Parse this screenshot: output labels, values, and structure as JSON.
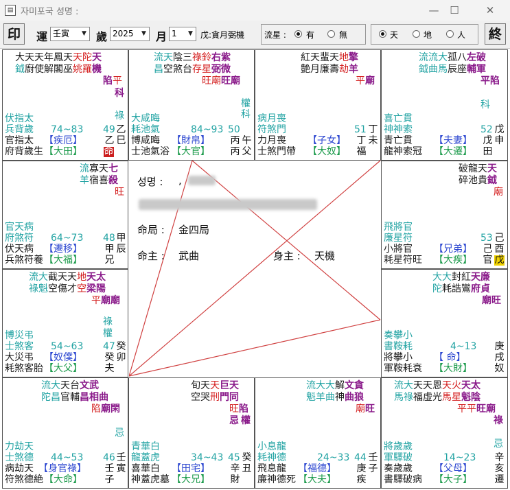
{
  "window": {
    "title": "자미포국  성명 :"
  },
  "toolbar": {
    "print_label": "印",
    "yun_label": "運",
    "yun_value": "壬寅",
    "sui_label": "歲",
    "sui_value": "2025",
    "yue_label": "月",
    "yue_value": "1",
    "sihua_text": "戊:貪月弼機",
    "liuxing_label": "流星 :",
    "liuxing_options": [
      "有",
      "無"
    ],
    "liuxing_selected": "有",
    "view_options": [
      "天",
      "地",
      "人"
    ],
    "view_selected": "天",
    "end_label": "終"
  },
  "center": {
    "name_label": "성명 :",
    "name_value": ",",
    "mingju_label": "命局 :",
    "mingju_value": "金四局",
    "mingzhu_label": "命主 :",
    "mingzhu_value": "武曲",
    "shenzhu_label": "身主 :",
    "shenzhu_value": "天機"
  },
  "cells": {
    "si": {
      "top": [
        [
          "大",
          "b"
        ],
        [
          "天",
          "b"
        ],
        [
          "天",
          "b"
        ],
        [
          "年",
          "b"
        ],
        [
          "鳳",
          "b"
        ],
        [
          "天",
          "b"
        ],
        [
          "天",
          "r"
        ],
        [
          "陀",
          "r"
        ],
        [
          "天",
          "m"
        ]
      ],
      "top2": [
        [
          "鉞",
          "g"
        ],
        [
          "廚",
          "b"
        ],
        [
          "使",
          "b"
        ],
        [
          "解",
          "b"
        ],
        [
          "閣",
          "b"
        ],
        [
          "巫",
          "b"
        ],
        [
          "姚",
          "r"
        ],
        [
          "羅",
          "r"
        ],
        [
          "機",
          "m"
        ]
      ],
      "top3": [
        [
          "陷",
          "m"
        ],
        [
          "平",
          "r"
        ]
      ],
      "hua": "科",
      "hua2": "祿",
      "r1": "伏指太",
      "r2": "兵背歲",
      "r3": "官指太",
      "r4": "府背歲生",
      "range": "74~83",
      "num": "49",
      "pal": "【疾厄】",
      "dpal": "【大田】",
      "g1": "乙",
      "g2": "乙",
      "z1": "巳",
      "ming": "命"
    },
    "wu": {
      "r1": "大咸晦",
      "r2": "耗池氣",
      "r3": "博咸晦",
      "r4": "士池氣浴",
      "range": "84~93",
      "num": "50",
      "pal": "【財帛】",
      "dpal": "【大官】",
      "g1": "丙",
      "z1": "午",
      "g2": "丙",
      "z2": "父",
      "hua": "權",
      "hua2": "科"
    },
    "wei": {
      "r1": "病月喪",
      "r2": "符煞門",
      "r3": "力月喪",
      "r4": "士煞門帶",
      "num": "51",
      "pal": "【子女】",
      "dpal": "【大奴】",
      "g1": "丁",
      "z1": "未",
      "g2": "丁",
      "z2": "福"
    },
    "shen": {
      "r1": "喜亡貫",
      "r2": "神神索",
      "r3": "青亡貫",
      "r4": "龍神索冠",
      "num": "52",
      "pal": "【夫妻】",
      "dpal": "【大遷】",
      "g1": "戊",
      "z1": "申",
      "g2": "戊",
      "z2": "田",
      "hua": "科"
    },
    "chen": {
      "r1": "官天病",
      "r2": "府煞符",
      "r3": "伏天病",
      "r4": "兵煞符養",
      "range": "64~73",
      "num": "48",
      "pal": "【遷移】",
      "dpal": "【大福】",
      "g1": "甲",
      "z1": "辰",
      "g2": "甲",
      "z2": "兄"
    },
    "you": {
      "r1": "飛將官",
      "r2": "廉星符",
      "r3": "小將官",
      "r4": "耗星符旺",
      "num": "53",
      "pal": "【兄弟】",
      "dpal": "【大疾】",
      "g1": "己",
      "z1": "酉",
      "g2": "己",
      "z2": "官",
      "shen": "戊"
    },
    "mao": {
      "r1": "博災弔",
      "r2": "士煞客",
      "r3": "大災弔",
      "r4": "耗煞客胎",
      "range": "54~63",
      "num": "47",
      "pal": "【奴僕】",
      "dpal": "【大父】",
      "g1": "癸",
      "z1": "卯",
      "g2": "癸",
      "z2": "夫",
      "hua": "祿",
      "hua2": "權"
    },
    "xu": {
      "r1": "奏攀小",
      "r2": "書鞍耗",
      "r3": "將攀小",
      "r4": "軍鞍耗衰",
      "range": "4~13",
      "pal": "【  命】",
      "dpal": "【大財】",
      "g1": "庚",
      "z1": "戌",
      "z2": "奴"
    },
    "yin": {
      "r1": "力劫天",
      "r2": "士煞德",
      "r3": "病劫天",
      "r4": "符煞德絶",
      "range": "44~53",
      "num": "46",
      "pal": "【身官祿】",
      "dpal": "【大命】",
      "g1": "壬",
      "z1": "寅",
      "g2": "壬",
      "z2": "子",
      "hua": "忌"
    },
    "chou": {
      "r1": "青華白",
      "r2": "龍蓋虎",
      "r3": "喜華白",
      "r4": "神蓋虎墓",
      "range": "34~43",
      "num": "45",
      "pal": "【田宅】",
      "dpal": "【大兄】",
      "g1": "癸",
      "z1": "丑",
      "g2": "辛",
      "z2": "財",
      "hua": "忌",
      "hua2": "權"
    },
    "zi": {
      "r1": "小息龍",
      "r2": "耗神德",
      "r3": "飛息龍",
      "r4": "廉神德死",
      "range": "24~33",
      "num": "44",
      "pal": "【福德】",
      "dpal": "【大夫】",
      "g1": "壬",
      "z1": "子",
      "g2": "庚",
      "z2": "疾"
    },
    "hai": {
      "r1": "將歲歲",
      "r2": "軍驛破",
      "r3": "奏歲歲",
      "r4": "書驛破病",
      "range": "14~23",
      "pal": "【父母】",
      "dpal": "【大子】",
      "g1": "辛",
      "z1": "亥",
      "z2": "遷",
      "hua": "忌",
      "hua2": "祿"
    }
  },
  "stars": {
    "wu_top": [
      [
        "流",
        "g"
      ],
      [
        "天",
        "g"
      ],
      [
        "陰",
        "b"
      ],
      [
        "三",
        "b"
      ],
      [
        "祿",
        "r"
      ],
      [
        "鈴",
        "r"
      ],
      [
        "右",
        "m"
      ],
      [
        "紫",
        "m"
      ]
    ],
    "wu_top2": [
      [
        "昌",
        "g"
      ],
      [
        "空",
        "b"
      ],
      [
        "煞",
        "b"
      ],
      [
        "台",
        "b"
      ],
      [
        "存",
        "r"
      ],
      [
        "星",
        "r"
      ],
      [
        "弼",
        "m"
      ],
      [
        "微",
        "m"
      ]
    ],
    "wu_top3": [
      [
        "旺",
        "r"
      ],
      [
        "廟",
        "r"
      ],
      [
        "旺",
        "m"
      ],
      [
        "廟",
        "m"
      ]
    ],
    "wei_top": [
      [
        "紅",
        "b"
      ],
      [
        "天",
        "b"
      ],
      [
        "蜚",
        "b"
      ],
      [
        "天",
        "b"
      ],
      [
        "地",
        "r"
      ],
      [
        "擎",
        "m"
      ]
    ],
    "wei_top2": [
      [
        "艶",
        "b"
      ],
      [
        "月",
        "b"
      ],
      [
        "廉",
        "b"
      ],
      [
        "壽",
        "b"
      ],
      [
        "劫",
        "r"
      ],
      [
        "羊",
        "m"
      ]
    ],
    "wei_top3": [
      [
        "平",
        "r"
      ],
      [
        "廟",
        "m"
      ]
    ],
    "shen_top": [
      [
        "流",
        "g"
      ],
      [
        "流",
        "g"
      ],
      [
        "大",
        "g"
      ],
      [
        "孤",
        "b"
      ],
      [
        "八",
        "b"
      ],
      [
        "左",
        "m"
      ],
      [
        "破",
        "m"
      ]
    ],
    "shen_top2": [
      [
        "鉞",
        "g"
      ],
      [
        "曲",
        "g"
      ],
      [
        "馬",
        "g"
      ],
      [
        "辰",
        "b"
      ],
      [
        "座",
        "b"
      ],
      [
        "輔",
        "m"
      ],
      [
        "軍",
        "m"
      ]
    ],
    "shen_top3": [
      [
        "平",
        "m"
      ],
      [
        "陷",
        "m"
      ]
    ],
    "chen_top": [
      [
        "流",
        "g"
      ],
      [
        "寡",
        "b"
      ],
      [
        "天",
        "b"
      ],
      [
        "七",
        "m"
      ]
    ],
    "chen_top2": [
      [
        "羊",
        "g"
      ],
      [
        "宿",
        "b"
      ],
      [
        "喜",
        "b"
      ],
      [
        "殺",
        "m"
      ]
    ],
    "chen_top3": [
      [
        "旺",
        "r"
      ]
    ],
    "you_top": [
      [
        "破",
        "b"
      ],
      [
        "龍",
        "b"
      ],
      [
        "天",
        "b"
      ],
      [
        "天",
        "m"
      ]
    ],
    "you_top2": [
      [
        "碎",
        "b"
      ],
      [
        "池",
        "b"
      ],
      [
        "貴",
        "b"
      ],
      [
        "鉞",
        "m"
      ]
    ],
    "you_top3": [
      [
        "廟",
        "r"
      ]
    ],
    "mao_top": [
      [
        "流",
        "g"
      ],
      [
        "大",
        "g"
      ],
      [
        "截",
        "b"
      ],
      [
        "天",
        "b"
      ],
      [
        "天",
        "b"
      ],
      [
        "地",
        "r"
      ],
      [
        "天",
        "m"
      ],
      [
        "太",
        "m"
      ]
    ],
    "mao_top2": [
      [
        "祿",
        "g"
      ],
      [
        "魁",
        "g"
      ],
      [
        "空",
        "b"
      ],
      [
        "傷",
        "b"
      ],
      [
        "才",
        "b"
      ],
      [
        "空",
        "r"
      ],
      [
        "梁",
        "m"
      ],
      [
        "陽",
        "m"
      ]
    ],
    "mao_top3": [
      [
        "平",
        "r"
      ],
      [
        "廟",
        "m"
      ],
      [
        "廟",
        "m"
      ]
    ],
    "xu_top": [
      [
        "大",
        "g"
      ],
      [
        "大",
        "g"
      ],
      [
        "封",
        "b"
      ],
      [
        "紅",
        "b"
      ],
      [
        "天",
        "m"
      ],
      [
        "廉",
        "m"
      ]
    ],
    "xu_top2": [
      [
        "陀",
        "g"
      ],
      [
        "耗",
        "b"
      ],
      [
        "誥",
        "b"
      ],
      [
        "鸞",
        "b"
      ],
      [
        "府",
        "m"
      ],
      [
        "貞",
        "m"
      ]
    ],
    "xu_top3": [
      [
        "廟",
        "m"
      ],
      [
        "旺",
        "m"
      ]
    ],
    "yin_top": [
      [
        "流",
        "g"
      ],
      [
        "大",
        "g"
      ],
      [
        "天",
        "b"
      ],
      [
        "台",
        "b"
      ],
      [
        "文",
        "m"
      ],
      [
        "武",
        "m"
      ]
    ],
    "yin_top2": [
      [
        "陀",
        "g"
      ],
      [
        "昌",
        "g"
      ],
      [
        "官",
        "b"
      ],
      [
        "輔",
        "b"
      ],
      [
        "昌",
        "m"
      ],
      [
        "相",
        "m"
      ],
      [
        "曲",
        "m"
      ]
    ],
    "yin_top3": [
      [
        "陷",
        "r"
      ],
      [
        "廟",
        "m"
      ],
      [
        "閑",
        "m"
      ]
    ],
    "chou_top": [
      [
        "旬",
        "b"
      ],
      [
        "天",
        "b"
      ],
      [
        "天",
        "r"
      ],
      [
        "巨",
        "m"
      ],
      [
        "天",
        "m"
      ]
    ],
    "chou_top2": [
      [
        "空",
        "b"
      ],
      [
        "哭",
        "b"
      ],
      [
        "刑",
        "r"
      ],
      [
        "門",
        "m"
      ],
      [
        "同",
        "m"
      ]
    ],
    "chou_top3": [
      [
        "旺",
        "r"
      ],
      [
        "陷",
        "m"
      ]
    ],
    "zi_top": [
      [
        "流",
        "g"
      ],
      [
        "大",
        "g"
      ],
      [
        "大",
        "g"
      ],
      [
        "解",
        "b"
      ],
      [
        "文",
        "m"
      ],
      [
        "貪",
        "m"
      ]
    ],
    "zi_top2": [
      [
        "魁",
        "g"
      ],
      [
        "羊",
        "g"
      ],
      [
        "曲",
        "g"
      ],
      [
        "神",
        "b"
      ],
      [
        "曲",
        "m"
      ],
      [
        "狼",
        "m"
      ]
    ],
    "zi_top3": [
      [
        "廟",
        "r"
      ],
      [
        "旺",
        "m"
      ]
    ],
    "hai_top": [
      [
        "流",
        "g"
      ],
      [
        "大",
        "g"
      ],
      [
        "天",
        "b"
      ],
      [
        "天",
        "b"
      ],
      [
        "恩",
        "b"
      ],
      [
        "天",
        "r"
      ],
      [
        "火",
        "r"
      ],
      [
        "天",
        "m"
      ],
      [
        "太",
        "m"
      ]
    ],
    "hai_top2": [
      [
        "馬",
        "g"
      ],
      [
        "祿",
        "g"
      ],
      [
        "福",
        "b"
      ],
      [
        "虛",
        "b"
      ],
      [
        "光",
        "b"
      ],
      [
        "馬",
        "r"
      ],
      [
        "星",
        "r"
      ],
      [
        "魁",
        "m"
      ],
      [
        "陰",
        "m"
      ]
    ],
    "hai_top3": [
      [
        "平",
        "r"
      ],
      [
        "平",
        "r"
      ],
      [
        "旺",
        "m"
      ],
      [
        "廟",
        "m"
      ]
    ]
  }
}
